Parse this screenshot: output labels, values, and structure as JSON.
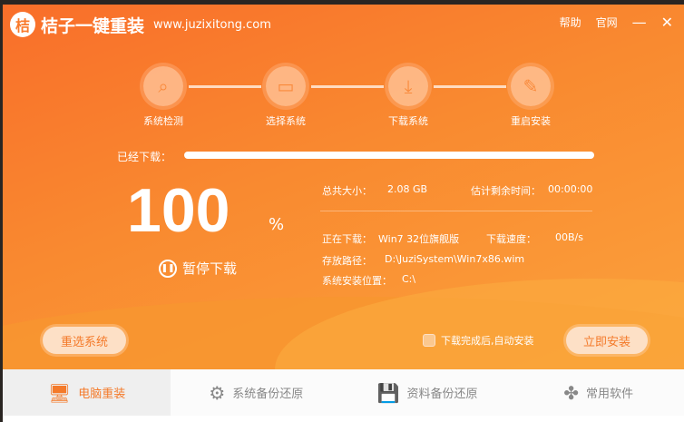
{
  "header": {
    "logo_mark": "桔",
    "app_name": "桔子一键重装",
    "url": "www.juzixitong.com",
    "help": "帮助",
    "website": "官网",
    "minimize": "—",
    "close": "✕"
  },
  "steps": [
    {
      "label": "系统检测",
      "icon": "⌕"
    },
    {
      "label": "选择系统",
      "icon": "▭"
    },
    {
      "label": "下载系统",
      "icon": "⤓"
    },
    {
      "label": "重启安装",
      "icon": "✎"
    }
  ],
  "progress": {
    "label": "已经下载：",
    "percent_value": 100,
    "percent": "100",
    "percent_sign": "%",
    "pause_label": "暂停下载"
  },
  "info": {
    "total_label": "总共大小：",
    "total_value": "2.08 GB",
    "remain_label": "估计剩余时间：",
    "remain_value": "00:00:00",
    "downloading_label": "正在下载：",
    "downloading_value": "Win7 32位旗舰版",
    "speed_label": "下载速度：",
    "speed_value": "00B/s",
    "path_label": "存放路径：",
    "path_value": "D:\\JuziSystem\\Win7x86.wim",
    "location_label": "系统安装位置：",
    "location_value": "C:\\"
  },
  "actions": {
    "reselect": "重选系统",
    "auto_install": "下载完成后,自动安装",
    "install_now": "立即安装"
  },
  "tabs": [
    {
      "label": "电脑重装",
      "icon": "🖥"
    },
    {
      "label": "系统备份还原",
      "icon": "⚙"
    },
    {
      "label": "资料备份还原",
      "icon": "💾"
    },
    {
      "label": "常用软件",
      "icon": "✤"
    }
  ],
  "colors": {
    "accent": "#f97a2c"
  }
}
